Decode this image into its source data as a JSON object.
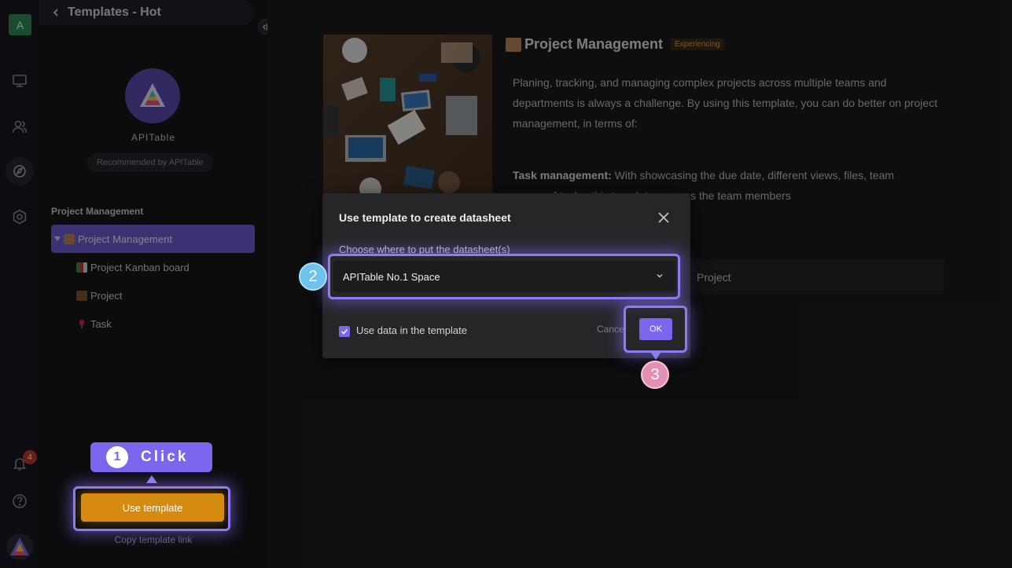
{
  "rail": {
    "space_initial": "A",
    "notification_count": "4"
  },
  "panel": {
    "header_title": "Templates - Hot",
    "brand_name": "APITable",
    "recommended_text": "Recommended by APITable",
    "section_title": "Project Management",
    "tree": [
      {
        "label": "Project Management",
        "selected": true
      },
      {
        "label": "Project Kanban board"
      },
      {
        "label": "Project"
      },
      {
        "label": "Task"
      }
    ],
    "use_template_label": "Use template",
    "copy_link_label": "Copy template link"
  },
  "main": {
    "title": "Project Management",
    "tag": "Experiencing",
    "description": "Planing, tracking, and managing complex projects across multiple teams and departments is always a challenge. By using this template, you can do better on project management, in terms of:",
    "task_heading": "Task management:",
    "task_text": "With showcasing the due date, different views, files, team",
    "task_text_2": "…of tasks, this template ensures the team members",
    "sheet_row_label": "Project"
  },
  "modal": {
    "title": "Use template to create datasheet",
    "choose_label": "Choose where to put the datasheet(s)",
    "selected_space": "APITable No.1 Space",
    "use_data_label": "Use data in the template",
    "use_data_checked": true,
    "cancel_label": "Cancel",
    "ok_label": "OK"
  },
  "tutorial": {
    "step1_number": "1",
    "step1_text": "Click",
    "step2_number": "2",
    "step3_number": "3"
  },
  "colors": {
    "accent": "#7b67ee",
    "use_template_button": "#d68b10",
    "step2": "#6fc3ea",
    "step3": "#e48fb4"
  }
}
